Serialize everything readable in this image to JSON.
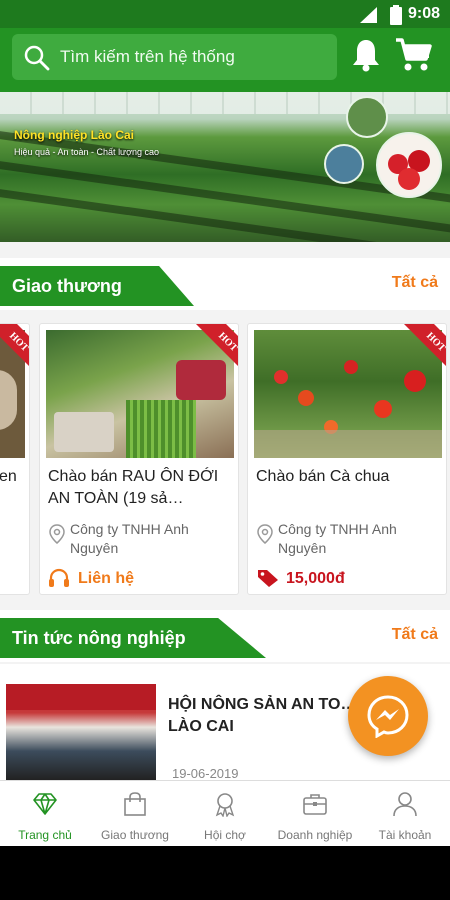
{
  "status": {
    "time": "9:08"
  },
  "search": {
    "placeholder": "Tìm kiếm trên hệ thống",
    "icon": "search-icon"
  },
  "header_icons": [
    "bell-icon",
    "cart-icon"
  ],
  "banner": {
    "title": "Nông nghiệp Lào Cai",
    "subtitle": "Hiệu quả - An toàn - Chất lượng cao"
  },
  "sections": {
    "trade": {
      "title": "Giao thương",
      "see_all": "Tất cả"
    },
    "news": {
      "title": "Tin tức nông nghiệp",
      "see_all": "Tất cả"
    }
  },
  "products": [
    {
      "name": "en",
      "badge": "HOT"
    },
    {
      "name": "Chào bán RAU ÔN ĐỚI AN TOÀN (19 sả…",
      "company": "Công ty TNHH Anh Nguyên",
      "price": "Liên hệ",
      "price_color": "#f07a1a",
      "price_icon": "headset-icon",
      "badge": "HOT"
    },
    {
      "name": "Chào bán Cà chua",
      "company": "Công ty TNHH Anh Nguyên",
      "price": "15,000đ",
      "price_color": "#c8141e",
      "price_icon": "tag-icon",
      "badge": "HOT"
    }
  ],
  "news": [
    {
      "headline": "HỘI NÔNG SẢN AN TO… LÀO CAI",
      "date": "19-06-2019"
    }
  ],
  "nav": [
    {
      "label": "Trang chủ",
      "icon": "diamond-icon",
      "active": true
    },
    {
      "label": "Giao thương",
      "icon": "shopping-bag-icon",
      "active": false
    },
    {
      "label": "Hội chợ",
      "icon": "medal-icon",
      "active": false
    },
    {
      "label": "Doanh nghiệp",
      "icon": "briefcase-icon",
      "active": false
    },
    {
      "label": "Tài khoản",
      "icon": "user-icon",
      "active": false
    }
  ],
  "colors": {
    "primary": "#239323",
    "accent": "#f07a1a",
    "price_red": "#c8141e"
  }
}
